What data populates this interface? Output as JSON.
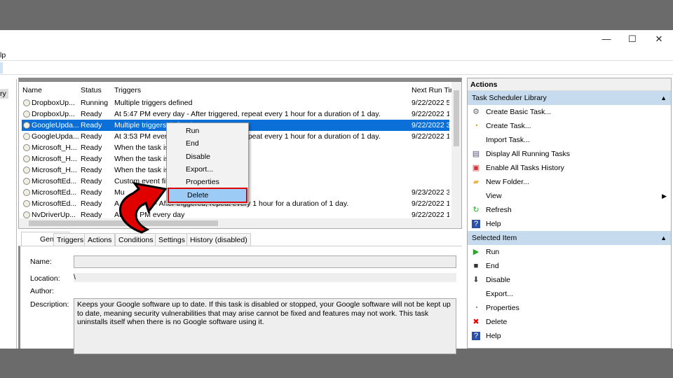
{
  "window": {
    "menu_fragment": "lp",
    "min": "—",
    "max": "☐",
    "close": "✕",
    "left_item": "ry"
  },
  "list": {
    "columns": [
      "Name",
      "Status",
      "Triggers",
      "Next Run Tir"
    ],
    "rows": [
      {
        "name": "DropboxUp...",
        "status": "Running",
        "triggers": "Multiple triggers defined",
        "next": "9/22/2022 5:"
      },
      {
        "name": "DropboxUp...",
        "status": "Ready",
        "triggers": "At 5:47 PM every day - After triggered, repeat every 1 hour for a duration of 1 day.",
        "next": "9/22/2022 12"
      },
      {
        "name": "GoogleUpda...",
        "status": "Ready",
        "triggers": "Multiple triggers defined",
        "next": "9/22/2022 3:",
        "selected": true
      },
      {
        "name": "GoogleUpda...",
        "status": "Ready",
        "triggers": "At 3:53 PM every day - After triggered, repeat every 1 hour for a duration of 1 day.",
        "next": "9/22/2022 12"
      },
      {
        "name": "Microsoft_H...",
        "status": "Ready",
        "triggers": "When the task is",
        "next": ""
      },
      {
        "name": "Microsoft_H...",
        "status": "Ready",
        "triggers": "When the task is",
        "next": ""
      },
      {
        "name": "Microsoft_H...",
        "status": "Ready",
        "triggers": "When the task is",
        "next": ""
      },
      {
        "name": "MicrosoftEd...",
        "status": "Ready",
        "triggers": "Custom event fil",
        "next": ""
      },
      {
        "name": "MicrosoftEd...",
        "status": "Ready",
        "triggers": "Mu",
        "next": "9/23/2022 3:"
      },
      {
        "name": "MicrosoftEd...",
        "status": "Ready",
        "triggers": "A                            every day - After triggered, repeat every 1 hour for a duration of 1 day.",
        "next": "9/22/2022 12"
      },
      {
        "name": "NvDriverUp...",
        "status": "Ready",
        "triggers": "At 3:25 PM every day",
        "next": "9/22/2022 12"
      }
    ]
  },
  "context_menu": [
    "Run",
    "End",
    "Disable",
    "Export...",
    "Properties",
    "Delete"
  ],
  "tabs": [
    "General",
    "Triggers",
    "Actions",
    "Conditions",
    "Settings",
    "History (disabled)"
  ],
  "details": {
    "name_label": "Name:",
    "location_label": "Location:",
    "location_value": "\\",
    "author_label": "Author:",
    "description_label": "Description:",
    "description": "Keeps your Google software up to date. If this task is disabled or stopped, your Google software will not be kept up to date, meaning security vulnerabilities that may arise cannot be fixed and features may not work. This task uninstalls itself when there is no Google software using it."
  },
  "actions": {
    "title": "Actions",
    "library_header": "Task Scheduler Library",
    "library_items": [
      "Create Basic Task...",
      "Create Task...",
      "Import Task...",
      "Display All Running Tasks",
      "Enable All Tasks History",
      "New Folder...",
      "View",
      "Refresh",
      "Help"
    ],
    "selected_header": "Selected Item",
    "selected_items": [
      "Run",
      "End",
      "Disable",
      "Export...",
      "Properties",
      "Delete",
      "Help"
    ]
  },
  "colors": {
    "selection": "#0a6fd6",
    "highlight": "#9ccbf5",
    "annotation": "#e00000",
    "section": "#c7dbef"
  }
}
